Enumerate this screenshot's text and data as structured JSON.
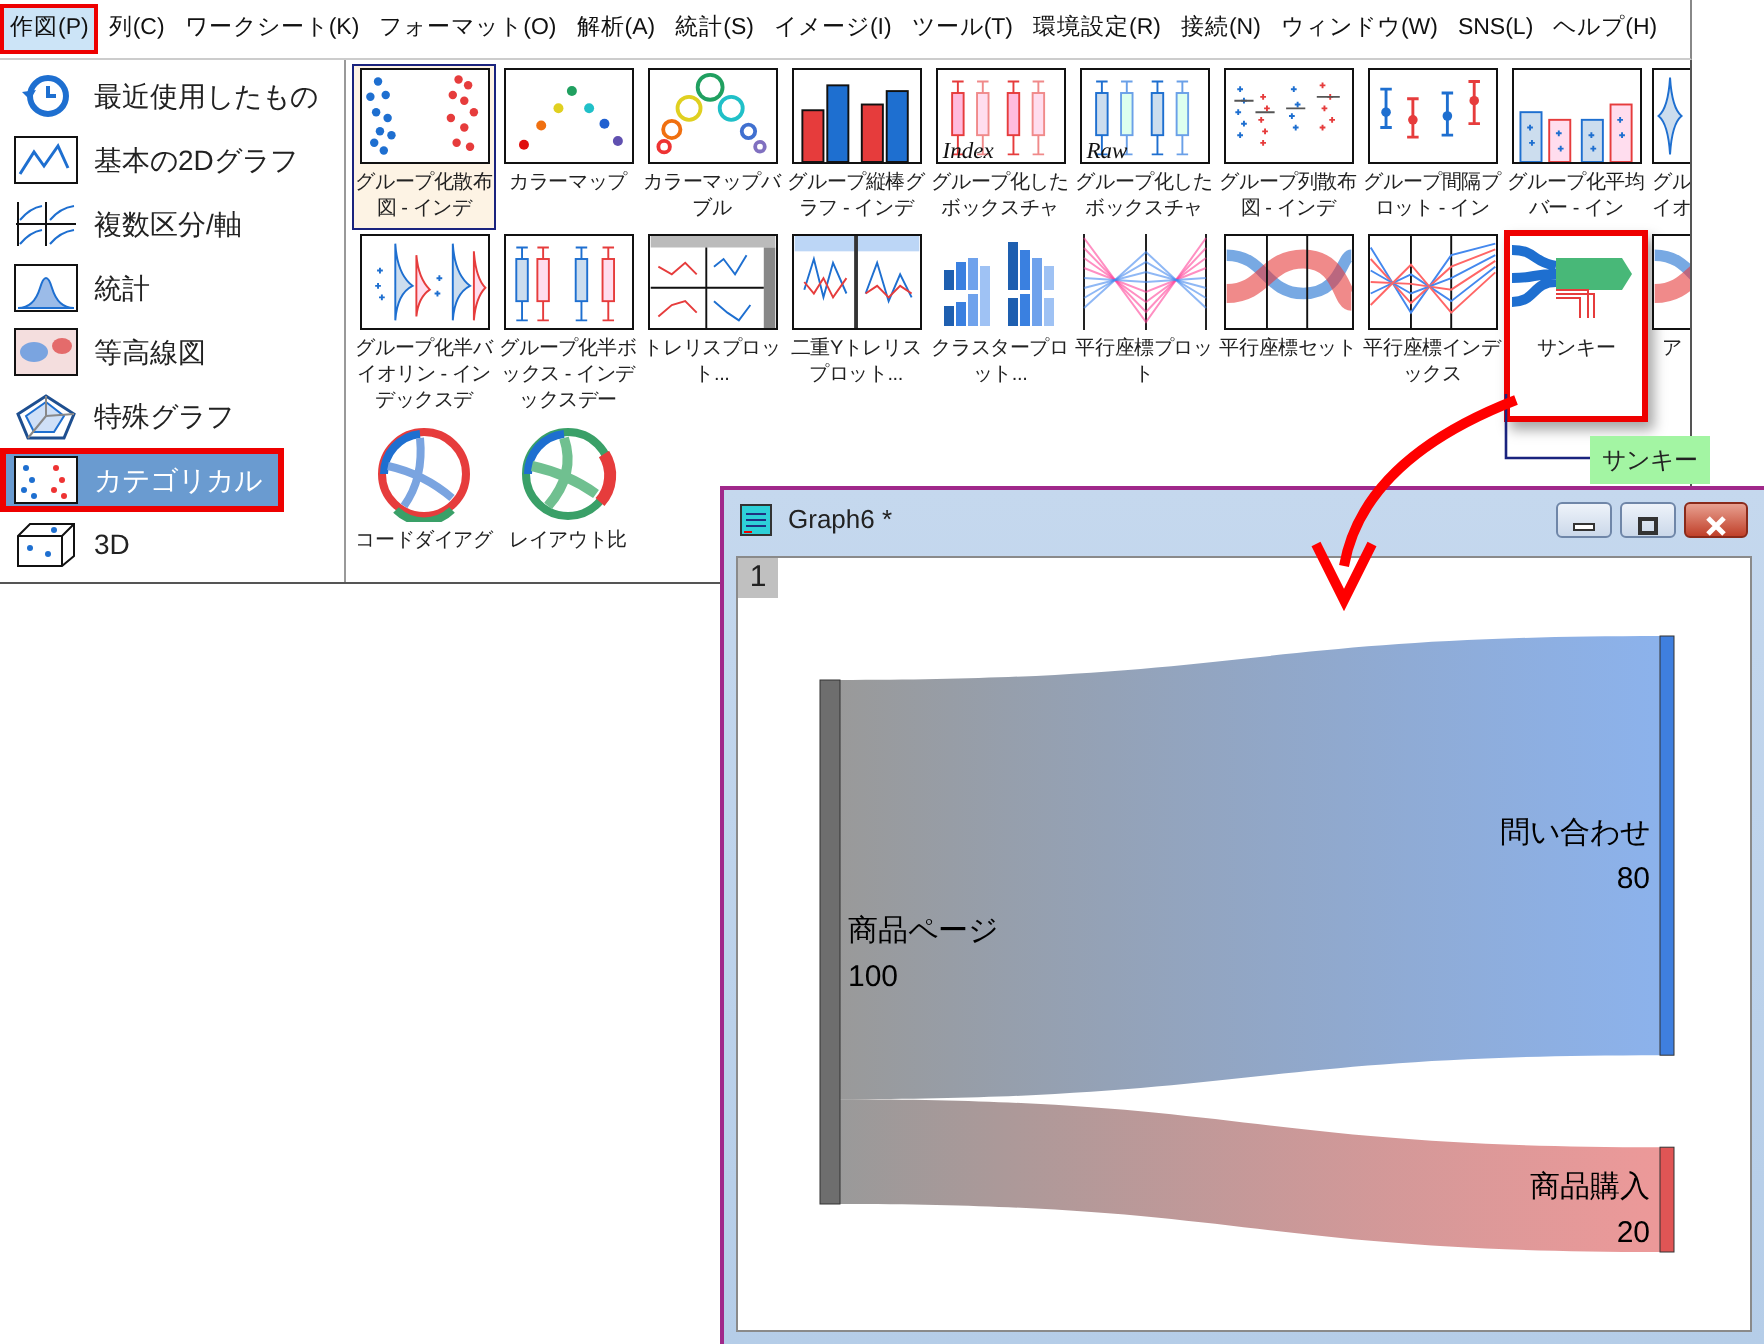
{
  "menu": [
    {
      "label": "作図(P)",
      "selected": true,
      "highlighted": true
    },
    {
      "label": "列(C)",
      "selected": false,
      "highlighted": false
    },
    {
      "label": "ワークシート(K)",
      "selected": false,
      "highlighted": false
    },
    {
      "label": "フォーマット(O)",
      "selected": false,
      "highlighted": false
    },
    {
      "label": "解析(A)",
      "selected": false,
      "highlighted": false
    },
    {
      "label": "統計(S)",
      "selected": false,
      "highlighted": false
    },
    {
      "label": "イメージ(I)",
      "selected": false,
      "highlighted": false
    },
    {
      "label": "ツール(T)",
      "selected": false,
      "highlighted": false
    },
    {
      "label": "環境設定(R)",
      "selected": false,
      "highlighted": false
    },
    {
      "label": "接続(N)",
      "selected": false,
      "highlighted": false
    },
    {
      "label": "ウィンドウ(W)",
      "selected": false,
      "highlighted": false
    },
    {
      "label": "SNS(L)",
      "selected": false,
      "highlighted": false
    },
    {
      "label": "ヘルプ(H)",
      "selected": false,
      "highlighted": false
    }
  ],
  "sidebar": {
    "items": [
      {
        "label": "最近使用したもの",
        "kind": "recent",
        "selected": false,
        "highlighted": false
      },
      {
        "label": "基本の2Dグラフ",
        "kind": "line",
        "selected": false,
        "highlighted": false
      },
      {
        "label": "複数区分/軸",
        "kind": "multi",
        "selected": false,
        "highlighted": false
      },
      {
        "label": "統計",
        "kind": "histogram",
        "selected": false,
        "highlighted": false
      },
      {
        "label": "等高線図",
        "kind": "contour",
        "selected": false,
        "highlighted": false
      },
      {
        "label": "特殊グラフ",
        "kind": "radar",
        "selected": false,
        "highlighted": false
      },
      {
        "label": "カテゴリカル",
        "kind": "categorical",
        "selected": true,
        "highlighted": true
      },
      {
        "label": "3D",
        "kind": "cube",
        "selected": false,
        "highlighted": false
      }
    ]
  },
  "gallery": {
    "rows": [
      {
        "items": [
          {
            "label": "グループ化散布図 - インデ",
            "kind": "scatter",
            "selected": true,
            "highlighted": false
          },
          {
            "label": "カラーマップ",
            "kind": "colormap",
            "selected": false,
            "highlighted": false
          },
          {
            "label": "カラーマップバブル",
            "kind": "bubble",
            "selected": false,
            "highlighted": false
          },
          {
            "label": "グループ縦棒グラフ - インデ",
            "kind": "column",
            "selected": false,
            "highlighted": false
          },
          {
            "label": "グループ化したボックスチャ",
            "kind": "box-red",
            "caption": "Index",
            "selected": false,
            "highlighted": false
          },
          {
            "label": "グループ化したボックスチャ",
            "kind": "box-blue",
            "caption": "Raw",
            "selected": false,
            "highlighted": false
          },
          {
            "label": "グループ列散布図 - インデ",
            "kind": "dotcol",
            "selected": false,
            "highlighted": false
          },
          {
            "label": "グループ間隔プロット - イン",
            "kind": "interval",
            "selected": false,
            "highlighted": false
          },
          {
            "label": "グループ化平均バー - イン",
            "kind": "meanbar",
            "selected": false,
            "highlighted": false
          },
          {
            "label": "グルイオ",
            "kind": "violin",
            "selected": false,
            "highlighted": false
          }
        ]
      },
      {
        "items": [
          {
            "label": "グループ化半バイオリン - インデックスデ",
            "kind": "halfviolin",
            "selected": false,
            "highlighted": false
          },
          {
            "label": "グループ化半ボックス - インデックスデー",
            "kind": "halfbox",
            "selected": false,
            "highlighted": false
          },
          {
            "label": "トレリスプロット...",
            "kind": "trellis",
            "selected": false,
            "highlighted": false
          },
          {
            "label": "二重Yトレリスプロット...",
            "kind": "trellis2",
            "selected": false,
            "highlighted": false
          },
          {
            "label": "クラスタープロット...",
            "kind": "cluster",
            "selected": false,
            "highlighted": false
          },
          {
            "label": "平行座標プロット",
            "kind": "parallel",
            "selected": false,
            "highlighted": false
          },
          {
            "label": "平行座標セット",
            "kind": "parallelset",
            "selected": false,
            "highlighted": false
          },
          {
            "label": "平行座標インデックス",
            "kind": "parallelidx",
            "selected": false,
            "highlighted": false
          },
          {
            "label": "サンキー",
            "kind": "sankey",
            "selected": false,
            "highlighted": true
          },
          {
            "label": "ア",
            "kind": "parallelset",
            "selected": false,
            "highlighted": false
          }
        ]
      },
      {
        "items": [
          {
            "label": "コードダイアグ",
            "kind": "chord",
            "selected": false,
            "highlighted": false
          },
          {
            "label": "レイアウト比",
            "kind": "chord2",
            "selected": false,
            "highlighted": false
          }
        ]
      }
    ]
  },
  "tooltip": {
    "text": "サンキー"
  },
  "graph_window": {
    "title": "Graph6 *",
    "layer_tab": "1",
    "sankey": {
      "sources": [
        {
          "label": "商品ページ",
          "value": "100",
          "color": "#6e6e6e",
          "targets": [
            {
              "label": "問い合わせ",
              "value": "80",
              "color": "#3f7fdf"
            },
            {
              "label": "商品購入",
              "value": "20",
              "color": "#e05555"
            }
          ]
        }
      ]
    }
  }
}
